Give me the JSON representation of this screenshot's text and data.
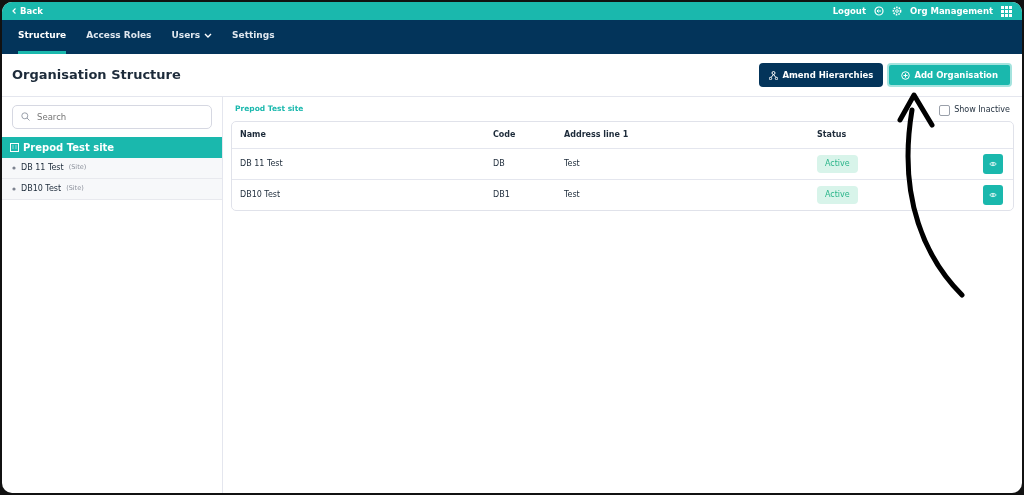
{
  "top_bar": {
    "back": "Back",
    "logout": "Logout",
    "app": "Org Management"
  },
  "tabs": [
    {
      "label": "Structure",
      "selected": true,
      "dropdown": false
    },
    {
      "label": "Access Roles",
      "selected": false,
      "dropdown": false
    },
    {
      "label": "Users",
      "selected": false,
      "dropdown": true
    },
    {
      "label": "Settings",
      "selected": false,
      "dropdown": false
    }
  ],
  "page_title": "Organisation Structure",
  "buttons": [
    {
      "label": "Amend Hierarchies",
      "kind": "hierarchy"
    },
    {
      "label": "Add Organisation",
      "kind": "add"
    }
  ],
  "sidebar": {
    "search": {
      "placeholder": "Search"
    },
    "root": {
      "label": "Prepod Test site",
      "selected": true,
      "children": [
        {
          "label": "DB 11 Test",
          "type": "(Site)"
        },
        {
          "label": "DB10 Test",
          "type": "(Site)"
        }
      ]
    }
  },
  "breadcrumb": "Prepod Test site",
  "show_inactive": {
    "label": "Show Inactive",
    "checked": false
  },
  "table": {
    "columns": [
      "Name",
      "Code",
      "Address line 1",
      "Status"
    ],
    "rows": [
      {
        "name": "DB 11 Test",
        "code": "DB",
        "address": "Test",
        "status": "Active"
      },
      {
        "name": "DB10 Test",
        "code": "DB1",
        "address": "Test",
        "status": "Active"
      }
    ]
  }
}
